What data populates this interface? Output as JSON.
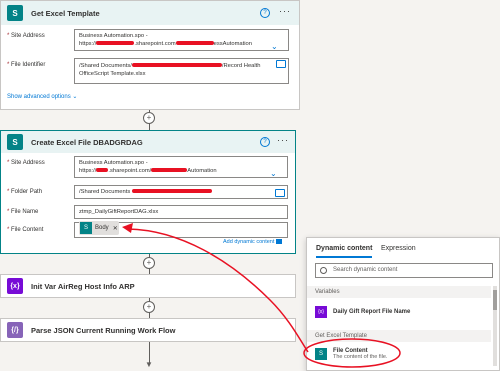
{
  "card1": {
    "title": "Get Excel Template",
    "site_label": "Site Address",
    "site_line1": "Business Automation.spo -",
    "site_line2_prefix": "https://",
    "site_line2_mid": ".sharepoint.com",
    "site_line2_suffix": "essAutomation",
    "file_label": "File Identifier",
    "file_line1_prefix": "/Shared Documents/",
    "file_line1_suffix": "/Record Health",
    "file_line2": "OfficeScript Template.xlsx",
    "advanced": "Show advanced options"
  },
  "card2": {
    "title": "Create Excel File DBADGRDAG",
    "site_label": "Site Address",
    "site_line1": "Business Automation.spo -",
    "site_line2_prefix": "https://",
    "site_line2_mid": ".sharepoint.com/",
    "site_line2_suffix": "Automation",
    "folder_label": "Folder Path",
    "folder_value": "/Shared Documents",
    "name_label": "File Name",
    "name_value": "ztmp_DailyGiftReportDAG.xlsx",
    "content_label": "File Content",
    "token_label": "Body",
    "add_dynamic": "Add dynamic content"
  },
  "card3": {
    "title": "Init Var AirReg Host Info ARP"
  },
  "card4": {
    "title": "Parse JSON Current Running Work Flow"
  },
  "dynamic_pane": {
    "tab_active": "Dynamic content",
    "tab_other": "Expression",
    "search_placeholder": "Search dynamic content",
    "section_variables": "Variables",
    "var_item": "Daily Gift Report File Name",
    "section_excel": "Get Excel Template",
    "item_title": "File Content",
    "item_desc": "The content of the file."
  },
  "colors": {
    "sharepoint": "#038387",
    "variable": "#770bd6",
    "link": "#0078d4",
    "annotation": "#e81123"
  }
}
